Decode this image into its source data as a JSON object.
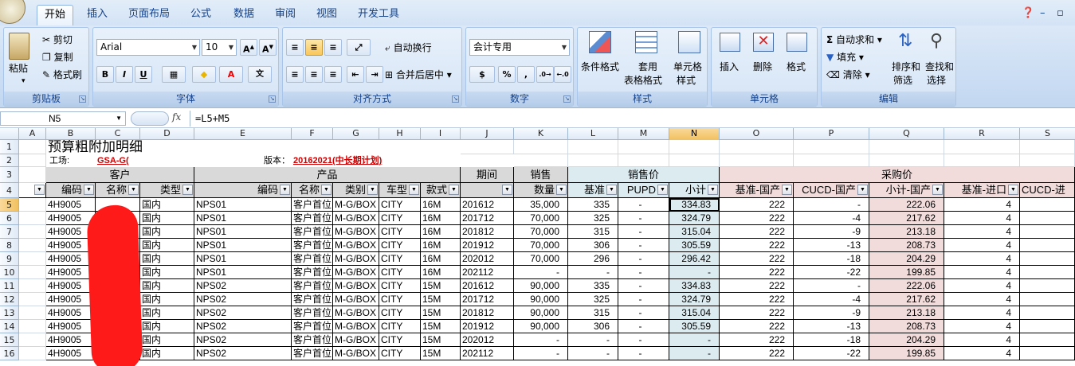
{
  "tabs": [
    "开始",
    "插入",
    "页面布局",
    "公式",
    "数据",
    "审阅",
    "视图",
    "开发工具"
  ],
  "clipboard": {
    "paste": "粘贴",
    "cut": "剪切",
    "copy": "复制",
    "format_painter": "格式刷",
    "label": "剪贴板"
  },
  "font": {
    "name": "Arial",
    "size": "10",
    "bold": "B",
    "italic": "I",
    "underline": "U",
    "label": "字体"
  },
  "align": {
    "wrap": "自动换行",
    "merge": "合并后居中",
    "label": "对齐方式"
  },
  "number": {
    "format": "会计专用",
    "percent": "%",
    "comma": ",",
    "label": "数字"
  },
  "styles": {
    "cond": "条件格式",
    "table1": "套用",
    "table2": "表格格式",
    "cell1": "单元格",
    "cell2": "样式",
    "label": "样式"
  },
  "cells": {
    "insert": "插入",
    "delete": "删除",
    "format": "格式",
    "label": "单元格"
  },
  "editing": {
    "autosum": "自动求和",
    "fill": "填充",
    "clear": "清除",
    "sort1": "排序和",
    "sort2": "筛选",
    "find1": "查找和",
    "find2": "选择",
    "label": "编辑"
  },
  "formula_bar": {
    "name_box": "N5",
    "fx": "fx",
    "formula": "=L5+M5"
  },
  "columns": [
    "A",
    "B",
    "C",
    "D",
    "E",
    "F",
    "G",
    "H",
    "I",
    "J",
    "K",
    "L",
    "M",
    "N",
    "O",
    "P",
    "Q",
    "R",
    "S"
  ],
  "rows": [
    "1",
    "2",
    "3",
    "4",
    "5",
    "6",
    "7",
    "8",
    "9",
    "10",
    "11",
    "12",
    "13",
    "14",
    "15",
    "16"
  ],
  "sheet": {
    "title": "预算粗附加明细",
    "factory_label": "工场:",
    "factory_value": "GSA-G(",
    "factory_close": ")",
    "version_label": "版本：",
    "version_value": "20162021(中长期计划)",
    "grp_customer": "客户",
    "grp_product": "产品",
    "grp_period": "期间",
    "grp_sales1": "销售",
    "grp_sales_price": "销售价",
    "grp_purchase": "采购价",
    "h_code": "编码",
    "h_name": "名称",
    "h_type": "类型",
    "h_pcode": "编码",
    "h_pname": "名称",
    "h_cat": "类别",
    "h_car": "车型",
    "h_style": "款式",
    "h_qty": "数量",
    "h_base": "基准",
    "h_pupd": "PUPD",
    "h_sub": "小计",
    "h_base_cn": "基准-国产",
    "h_cucd_cn": "CUCD-国产",
    "h_sub_cn": "小计-国产",
    "h_base_imp": "基准-进口",
    "h_cucd_imp": "CUCD-进"
  },
  "data": [
    [
      "4H9005",
      "国内",
      "NPS01",
      "客户首位",
      "M-G/BOX",
      "CITY",
      "16M",
      "201612",
      "35,000",
      "335",
      "-",
      "334.83",
      "222",
      "-",
      "222.06",
      "4"
    ],
    [
      "4H9005",
      "国内",
      "NPS01",
      "客户首位",
      "M-G/BOX",
      "CITY",
      "16M",
      "201712",
      "70,000",
      "325",
      "-",
      "324.79",
      "222",
      "-4",
      "217.62",
      "4"
    ],
    [
      "4H9005",
      "国内",
      "NPS01",
      "客户首位",
      "M-G/BOX",
      "CITY",
      "16M",
      "201812",
      "70,000",
      "315",
      "-",
      "315.04",
      "222",
      "-9",
      "213.18",
      "4"
    ],
    [
      "4H9005",
      "国内",
      "NPS01",
      "客户首位",
      "M-G/BOX",
      "CITY",
      "16M",
      "201912",
      "70,000",
      "306",
      "-",
      "305.59",
      "222",
      "-13",
      "208.73",
      "4"
    ],
    [
      "4H9005",
      "国内",
      "NPS01",
      "客户首位",
      "M-G/BOX",
      "CITY",
      "16M",
      "202012",
      "70,000",
      "296",
      "-",
      "296.42",
      "222",
      "-18",
      "204.29",
      "4"
    ],
    [
      "4H9005",
      "国内",
      "NPS01",
      "客户首位",
      "M-G/BOX",
      "CITY",
      "16M",
      "202112",
      "-",
      "-",
      "-",
      "-",
      "222",
      "-22",
      "199.85",
      "4"
    ],
    [
      "4H9005",
      "国内",
      "NPS02",
      "客户首位",
      "M-G/BOX",
      "CITY",
      "15M",
      "201612",
      "90,000",
      "335",
      "-",
      "334.83",
      "222",
      "-",
      "222.06",
      "4"
    ],
    [
      "4H9005",
      "国内",
      "NPS02",
      "客户首位",
      "M-G/BOX",
      "CITY",
      "15M",
      "201712",
      "90,000",
      "325",
      "-",
      "324.79",
      "222",
      "-4",
      "217.62",
      "4"
    ],
    [
      "4H9005",
      "国内",
      "NPS02",
      "客户首位",
      "M-G/BOX",
      "CITY",
      "15M",
      "201812",
      "90,000",
      "315",
      "-",
      "315.04",
      "222",
      "-9",
      "213.18",
      "4"
    ],
    [
      "4H9005",
      "国内",
      "NPS02",
      "客户首位",
      "M-G/BOX",
      "CITY",
      "15M",
      "201912",
      "90,000",
      "306",
      "-",
      "305.59",
      "222",
      "-13",
      "208.73",
      "4"
    ],
    [
      "4H9005",
      "国内",
      "NPS02",
      "客户首位",
      "M-G/BOX",
      "CITY",
      "15M",
      "202012",
      "-",
      "-",
      "-",
      "-",
      "222",
      "-18",
      "204.29",
      "4"
    ],
    [
      "4H9005",
      "国内",
      "NPS02",
      "客户首位",
      "M-G/BOX",
      "CITY",
      "15M",
      "202112",
      "-",
      "-",
      "-",
      "-",
      "222",
      "-22",
      "199.85",
      "4"
    ]
  ]
}
